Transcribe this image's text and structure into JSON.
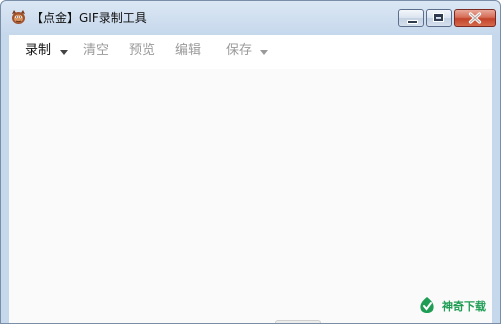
{
  "window": {
    "title": "【点金】GIF录制工具",
    "app_icon": "goblin-app-icon"
  },
  "title_controls": {
    "minimize": "minimize-icon",
    "maximize": "maximize-icon",
    "close": "close-icon"
  },
  "toolbar": {
    "record_label": "录制",
    "clear_label": "清空",
    "preview_label": "预览",
    "edit_label": "编辑",
    "save_label": "保存"
  },
  "watermark": {
    "logo": "shenqi-logo",
    "text": "神奇下载"
  },
  "colors": {
    "title_bar": "#c6d8ec",
    "close_button": "#c2432a",
    "toolbar_text_active": "#111111",
    "toolbar_text_disabled": "#9a9a9a",
    "watermark_green": "#1f9d55"
  }
}
